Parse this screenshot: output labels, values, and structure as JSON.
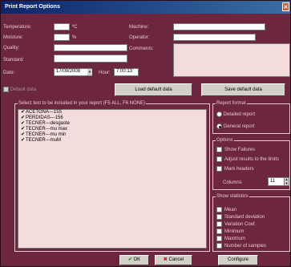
{
  "window": {
    "title": "Print Report Options"
  },
  "fields": {
    "temperature_label": "Temperature:",
    "temperature_unit": "ºC",
    "moisture_label": "Moisture:",
    "moisture_unit": "%",
    "quality_label": "Quality:",
    "standard_label": "Standard:",
    "date_label": "Date:",
    "date_value": "17/09/2008",
    "hour_label": "Hour:",
    "hour_value": "7:00:13",
    "machine_label": "Machine:",
    "operator_label": "Operator:",
    "comments_label": "Comments:"
  },
  "defaults": {
    "default_data_label": "Default data",
    "load_label": "Load default data",
    "save_label": "Save default data"
  },
  "text_list": {
    "title": "Select text to be included in your report (F5 ALL, F6 NONE)",
    "items": [
      "ACETONA---155",
      "PERDIDAS---156",
      "TECNER---desgaste",
      "TECNER---mu max",
      "TECNER---mu min",
      "TECNER---muM"
    ]
  },
  "report_format": {
    "title": "Report format",
    "detailed": "Detailed report",
    "general": "General report"
  },
  "options": {
    "title": "Options",
    "show_failures": "Show Failures",
    "adjust": "Adjust results to the limits",
    "mark_headers": "Mark headers",
    "columns_label": "Columns",
    "columns_value": "11"
  },
  "statistics": {
    "title": "Show statistics",
    "items": [
      "Mean",
      "Standard deviation",
      "Variation Coef.",
      "Minimum",
      "Maximum",
      "Number of samples"
    ]
  },
  "buttons": {
    "ok": "OK",
    "cancel": "Cancel",
    "configure": "Configure"
  },
  "colors": {
    "background": "#6c2640",
    "label": "#e8c8c8",
    "title_bar": "#0a246a"
  }
}
